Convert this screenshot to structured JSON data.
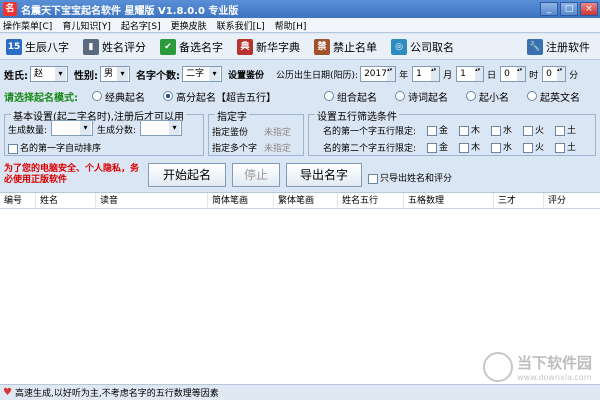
{
  "window": {
    "title": "名震天下宝宝起名软件 星耀版 V1.8.0.0    专业版",
    "minimize": "_",
    "maximize": "□",
    "close": "×"
  },
  "menu": [
    "操作菜单[C]",
    "育儿知识[Y]",
    "起名字[S]",
    "更换皮肤",
    "联系我们[L]",
    "帮助[H]"
  ],
  "toolbar": {
    "items": [
      {
        "label": "生辰八字",
        "icon": "15",
        "color": "#2b6cc4"
      },
      {
        "label": "姓名评分",
        "icon": "▮",
        "color": "#5a6b80"
      },
      {
        "label": "备选名字",
        "icon": "✔",
        "color": "#2a9a3a"
      },
      {
        "label": "新华字典",
        "icon": "典",
        "color": "#b8332e"
      },
      {
        "label": "禁止名单",
        "icon": "禁",
        "color": "#a0522d"
      },
      {
        "label": "公司取名",
        "icon": "◎",
        "color": "#2e8bc0"
      }
    ],
    "register": {
      "label": "注册软件",
      "icon": "🔧",
      "color": "#3a6fb0"
    }
  },
  "form": {
    "surname_label": "姓氏:",
    "surname": "赵",
    "gender_label": "性别:",
    "gender": "男",
    "count_label": "名字个数:",
    "count": "二字",
    "settings_label": "设置鉴份",
    "birth_label": "公历出生日期(阳历):",
    "year": "2017",
    "year_unit": "年",
    "month": "1",
    "month_unit": "月",
    "day": "1",
    "day_unit": "日",
    "hour": "0",
    "hour_unit": "时",
    "minute": "0",
    "minute_unit": "分"
  },
  "mode": {
    "label": "请选择起名模式:",
    "options": [
      {
        "label": "经典起名",
        "on": false
      },
      {
        "label": "高分起名【超吉五行】",
        "on": true
      },
      {
        "label": "组合起名",
        "on": false
      },
      {
        "label": "诗词起名",
        "on": false
      },
      {
        "label": "起小名",
        "on": false
      },
      {
        "label": "起英文名",
        "on": false
      }
    ]
  },
  "basic": {
    "title": "基本设置(起二字名时),注册后才可以用",
    "gen_count_label": "生成数量:",
    "gen_score_label": "生成分数:",
    "auto_sort_label": "名的第一字自动排序"
  },
  "specify": {
    "title": "指定字",
    "row1_label": "指定鉴份",
    "row1_value": "未指定",
    "row2_label": "指定多个字",
    "row2_value": "未指定"
  },
  "wuxing": {
    "title": "设置五行筛选条件",
    "row1_label": "名的第一个字五行限定:",
    "row2_label": "名的第二个字五行限定:",
    "elements": [
      "金",
      "木",
      "水",
      "火",
      "土"
    ]
  },
  "notice": "为了您的电脑安全、个人隐私，务必使用正版软件",
  "actions": {
    "start": "开始起名",
    "stop": "停止",
    "export": "导出名字",
    "export_only_label": "只导出姓名和评分"
  },
  "table": {
    "columns": [
      "编号",
      "姓名",
      "读音",
      "简体笔画",
      "繁体笔画",
      "姓名五行",
      "五格数理",
      "三才",
      "评分"
    ]
  },
  "status": "高速生成,以好听为主,不考虑名字的五行数理等因素",
  "watermark": {
    "text": "当下软件园",
    "sub": "www.downxia.com"
  }
}
